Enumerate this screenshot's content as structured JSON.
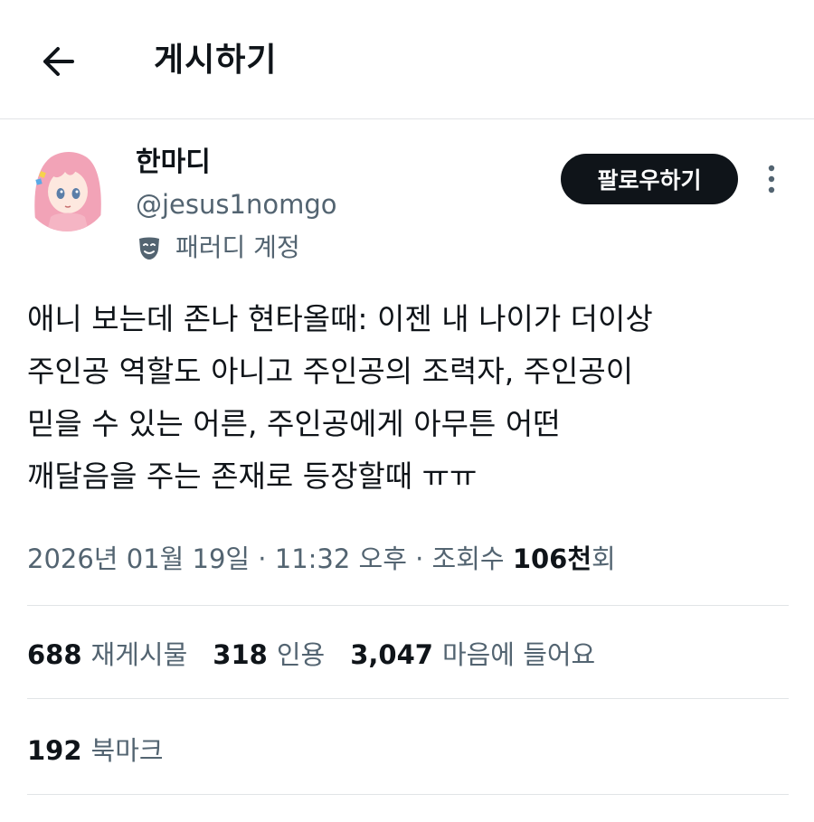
{
  "header": {
    "title": "게시하기",
    "back_icon": "arrow-left-icon"
  },
  "author": {
    "name": "한마디",
    "handle": "@jesus1nomgo",
    "badge_label": "패러디 계정",
    "badge_icon": "theater-mask-icon",
    "avatar_icon": "anime-girl-avatar"
  },
  "actions": {
    "follow_label": "팔로우하기",
    "more_icon": "more-vertical-icon"
  },
  "tweet": {
    "lines": [
      "애니 보는데 존나 현타올때: 이젠 내 나이가 더이상",
      "주인공 역할도 아니고 주인공의 조력자, 주인공이",
      "믿을 수 있는 어른, 주인공에게 아무튼 어떤",
      "깨달음을 주는 존재로 등장할때 ㅠㅠ"
    ]
  },
  "meta": {
    "timestamp": "2026년 01월 19일 · 11:32 오후 · 조회수 ",
    "views_number": "106천",
    "views_suffix": "회"
  },
  "stats": {
    "reposts_count": "688",
    "reposts_label": "재게시물",
    "quotes_count": "318",
    "quotes_label": "인용",
    "likes_count": "3,047",
    "likes_label": "마음에 들어요",
    "bookmarks_count": "192",
    "bookmarks_label": "북마크"
  },
  "colors": {
    "text_primary": "#0f1419",
    "text_secondary": "#536471",
    "divider": "#e1e4e6",
    "follow_bg": "#0f1419",
    "avatar_hair": "#f2a3b7"
  }
}
